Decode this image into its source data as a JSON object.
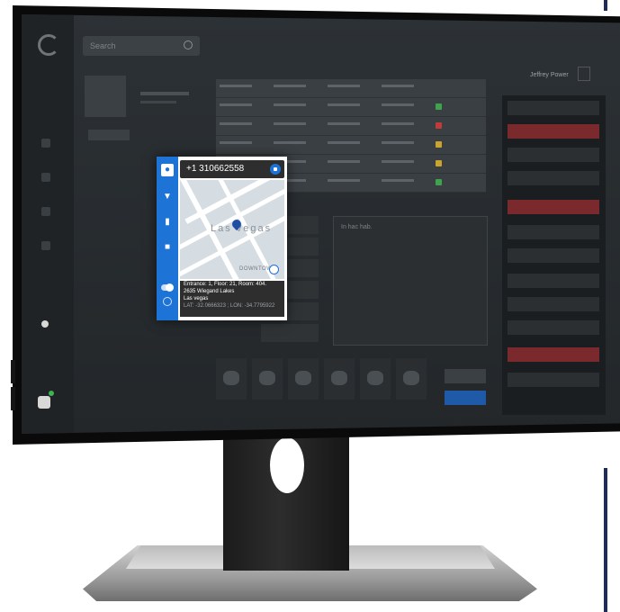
{
  "dashboard": {
    "search_placeholder": "Search",
    "user_name": "Jeffrey Power",
    "mid_panel_title": "In hac hab."
  },
  "popup": {
    "phone": "+1 310662558",
    "map_city": "Las vegas",
    "map_district": "DOWNTOWN",
    "address": {
      "line1": "Entrance: 1, Floor: 21, Room: 404.",
      "line2": "2635 Wiegand Lakes",
      "line3": "Las vegas",
      "coords": "LAT: -32.0666323 ; LON: -34.7795922"
    },
    "side_icons": [
      "person-icon",
      "location-pin-icon",
      "video-camera-icon",
      "chat-icon"
    ]
  },
  "colors": {
    "accent": "#1e73d6",
    "alert": "#7a2a2d",
    "screen_bg": "#2c3135"
  }
}
